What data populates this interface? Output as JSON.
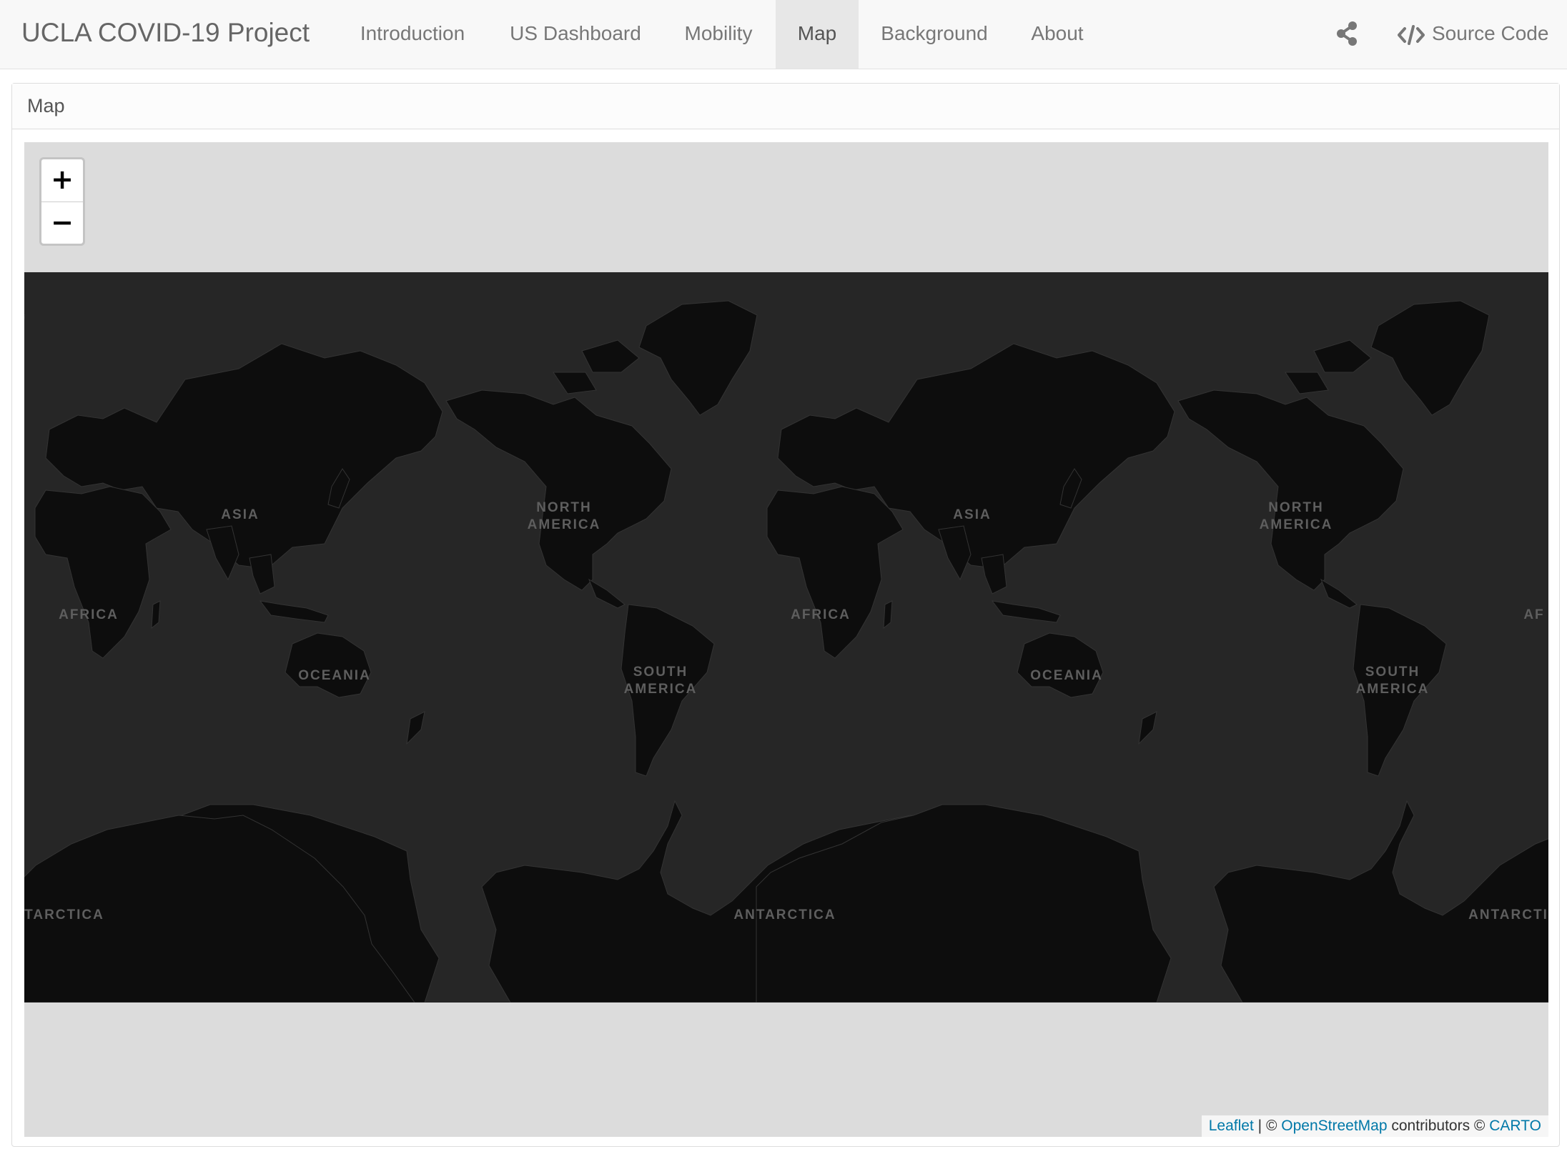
{
  "navbar": {
    "brand": "UCLA COVID-19 Project",
    "items": [
      {
        "label": "Introduction",
        "active": false
      },
      {
        "label": "US Dashboard",
        "active": false
      },
      {
        "label": "Mobility",
        "active": false
      },
      {
        "label": "Map",
        "active": true
      },
      {
        "label": "Background",
        "active": false
      },
      {
        "label": "About",
        "active": false
      }
    ],
    "share_icon": "share-icon",
    "source_code": {
      "icon": "code-icon",
      "label": "Source Code"
    }
  },
  "panel": {
    "heading": "Map"
  },
  "map": {
    "zoom_in": "+",
    "zoom_out": "−",
    "labels": {
      "asia": "ASIA",
      "africa": "AFRICA",
      "north_america": "NORTH\nAMERICA",
      "south_america": "SOUTH\nAMERICA",
      "oceania": "OCEANIA",
      "antarctica": "ANTARCTICA",
      "antarctica_partial_left": "TARCTICA",
      "antarctica_partial_right": "ANTARCTI",
      "africa_partial_right": "AF"
    },
    "colors": {
      "ocean": "#262626",
      "land": "#0d0d0d",
      "background": "#dcdcdc"
    },
    "attribution": {
      "leaflet": "Leaflet",
      "separator": "| ©",
      "osm": "OpenStreetMap",
      "contributors": "contributors ©",
      "carto": "CARTO"
    }
  }
}
